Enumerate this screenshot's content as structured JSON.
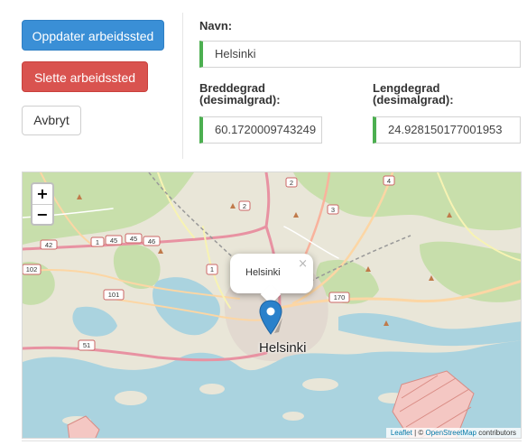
{
  "actions": {
    "update_label": "Oppdater arbeidssted",
    "delete_label": "Slette arbeidssted",
    "cancel_label": "Avbryt"
  },
  "form": {
    "name_label": "Navn:",
    "name_value": "Helsinki",
    "lat_label_line1": "Breddegrad",
    "lat_label_line2": "(desimalgrad):",
    "lat_value": "60.1720009743249",
    "lng_label_line1": "Lengdegrad",
    "lng_label_line2": "(desimalgrad):",
    "lng_value": "24.928150177001953"
  },
  "map": {
    "zoom_in": "+",
    "zoom_out": "−",
    "popup_text": "Helsinki",
    "popup_close": "×",
    "city_label": "Helsinki",
    "road_shields": [
      "42",
      "1",
      "45",
      "45",
      "46",
      "102",
      "101",
      "51",
      "1",
      "170",
      "2",
      "2",
      "3",
      "4"
    ],
    "attribution": {
      "leaflet": "Leaflet",
      "separator": " | © ",
      "osm": "OpenStreetMap",
      "suffix": " contributors"
    }
  },
  "colors": {
    "primary": "#3a8fd6",
    "danger": "#d9534f",
    "valid_border": "#4caf50",
    "marker": "#2a81cb",
    "water": "#aad3df",
    "forest": "#c8dfae",
    "urban": "#e8e3d3"
  }
}
